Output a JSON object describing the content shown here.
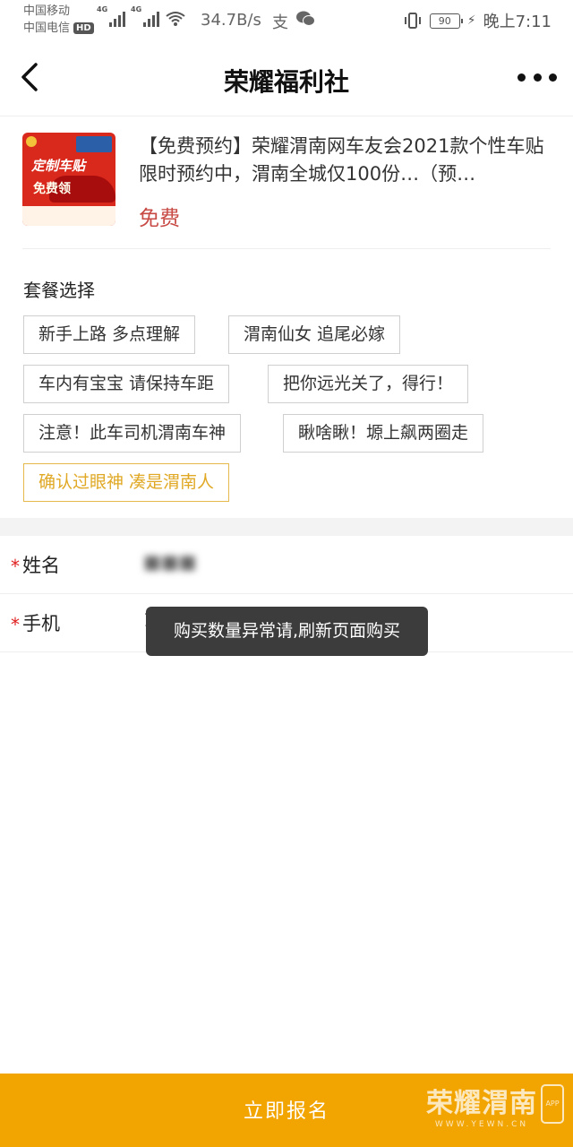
{
  "status_bar": {
    "carrier_1": "中国移动",
    "carrier_2": "中国电信",
    "hd_badge": "HD",
    "network_1": "4G",
    "network_2": "4G",
    "net_speed": "34.7B/s",
    "battery": "90",
    "time": "晚上7:11"
  },
  "nav": {
    "title": "荣耀福利社"
  },
  "product": {
    "title": "【免费预约】荣耀渭南网车友会2021款个性车贴限时预约中，渭南全城仅100份…（预…",
    "price": "免费",
    "thumb_text_1": "定制车贴",
    "thumb_text_2": "免费领"
  },
  "packages": {
    "label": "套餐选择",
    "options": [
      "新手上路 多点理解",
      "渭南仙女 追尾必嫁",
      "车内有宝宝 请保持车距",
      "把你远光关了，得行！",
      "注意！此车司机渭南车神",
      "瞅啥瞅！塬上飙两圈走",
      "确认过眼神 凑是渭南人"
    ],
    "selected_index": 6
  },
  "form": {
    "required_mark": "*",
    "name_label": "姓名",
    "name_value": "■■■",
    "phone_label": "手机",
    "phone_value": "13572799999"
  },
  "toast": {
    "message": "购买数量异常请,刷新页面购买"
  },
  "footer": {
    "signup_label": "立即报名",
    "watermark_cn": "荣耀渭南",
    "watermark_url": "WWW.YEWN.CN",
    "watermark_app": "APP"
  },
  "colors": {
    "accent_orange": "#f2a400",
    "price_red": "#c84a45",
    "selected_chip": "#e0a824",
    "required_red": "#e02020"
  }
}
